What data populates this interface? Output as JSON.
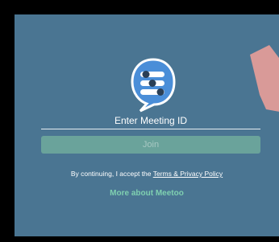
{
  "app": {
    "logo_icon": "speech-bubble-sliders-icon"
  },
  "form": {
    "meeting_id_placeholder": "Enter Meeting ID",
    "meeting_id_value": "",
    "join_label": "Join"
  },
  "consent": {
    "prefix": "By continuing, I accept the ",
    "link_label": "Terms & Privacy Policy"
  },
  "footer": {
    "more_label": "More about Meetoo"
  },
  "colors": {
    "background": "#4a7592",
    "join_button": "#6aa39b",
    "accent_link": "#7fd0b0",
    "annotation_arrow": "#d99a98"
  }
}
